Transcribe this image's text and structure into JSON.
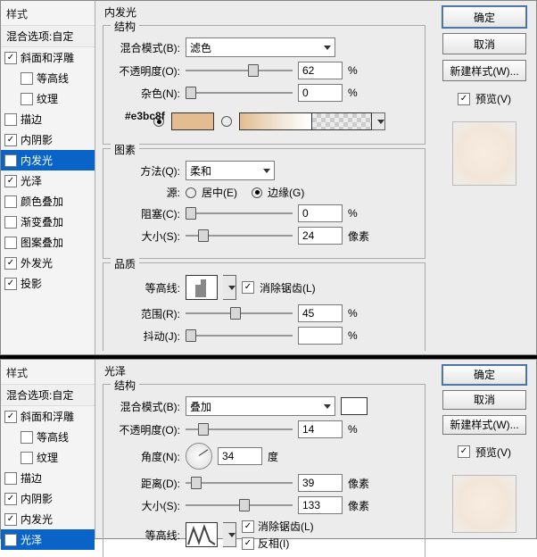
{
  "top": {
    "styleHead": "样式",
    "blendSub": "混合选项:自定",
    "title": "内发光",
    "items": [
      {
        "label": "斜面和浮雕",
        "checked": true,
        "indent": false
      },
      {
        "label": "等高线",
        "checked": false,
        "indent": true
      },
      {
        "label": "纹理",
        "checked": false,
        "indent": true
      },
      {
        "label": "描边",
        "checked": false,
        "indent": false
      },
      {
        "label": "内阴影",
        "checked": true,
        "indent": false
      },
      {
        "label": "内发光",
        "checked": true,
        "indent": false,
        "sel": true
      },
      {
        "label": "光泽",
        "checked": true,
        "indent": false
      },
      {
        "label": "颜色叠加",
        "checked": false,
        "indent": false
      },
      {
        "label": "渐变叠加",
        "checked": false,
        "indent": false
      },
      {
        "label": "图案叠加",
        "checked": false,
        "indent": false
      },
      {
        "label": "外发光",
        "checked": true,
        "indent": false
      },
      {
        "label": "投影",
        "checked": true,
        "indent": false
      }
    ],
    "struct": {
      "legend": "结构",
      "blendLabel": "混合模式(B):",
      "blendVal": "滤色",
      "opacityLabel": "不透明度(O):",
      "opacity": "62",
      "opUnit": "%",
      "noiseLabel": "杂色(N):",
      "noise": "0",
      "noiseUnit": "%",
      "hex": "#e3bc8f"
    },
    "elements": {
      "legend": "图素",
      "methodLabel": "方法(Q):",
      "methodVal": "柔和",
      "sourceLabel": "源:",
      "centerLabel": "居中(E)",
      "edgeLabel": "边缘(G)",
      "chokeLabel": "阻塞(C):",
      "choke": "0",
      "chokeUnit": "%",
      "sizeLabel": "大小(S):",
      "size": "24",
      "sizeUnit": "像素"
    },
    "quality": {
      "legend": "品质",
      "contourLabel": "等高线:",
      "antiLabel": "消除锯齿(L)",
      "rangeLabel": "范围(R):",
      "range": "45",
      "rangeUnit": "%",
      "jitterLabel": "抖动(J):",
      "jitter": " ",
      "jitterUnit": "%"
    },
    "buttons": {
      "ok": "确定",
      "cancel": "取消",
      "newStyle": "新建样式(W)...",
      "preview": "预览(V)"
    }
  },
  "bottom": {
    "styleHead": "样式",
    "blendSub": "混合选项:自定",
    "title": "光泽",
    "items": [
      {
        "label": "斜面和浮雕",
        "checked": true,
        "indent": false
      },
      {
        "label": "等高线",
        "checked": false,
        "indent": true
      },
      {
        "label": "纹理",
        "checked": false,
        "indent": true
      },
      {
        "label": "描边",
        "checked": false,
        "indent": false
      },
      {
        "label": "内阴影",
        "checked": true,
        "indent": false
      },
      {
        "label": "内发光",
        "checked": true,
        "indent": false
      },
      {
        "label": "光泽",
        "checked": true,
        "indent": false,
        "sel": true
      }
    ],
    "struct": {
      "legend": "结构",
      "blendLabel": "混合模式(B):",
      "blendVal": "叠加",
      "opacityLabel": "不透明度(O):",
      "opacity": "14",
      "opUnit": "%",
      "angleLabel": "角度(N):",
      "angle": "34",
      "angleUnit": "度",
      "distLabel": "距离(D):",
      "dist": "39",
      "distUnit": "像素",
      "sizeLabel": "大小(S):",
      "size": "133",
      "sizeUnit": "像素",
      "contourLabel": "等高线:",
      "antiLabel": "消除锯齿(L)",
      "invertLabel": "反相(I)"
    },
    "buttons": {
      "ok": "确定",
      "cancel": "取消",
      "newStyle": "新建样式(W)...",
      "preview": "预览(V)"
    }
  }
}
